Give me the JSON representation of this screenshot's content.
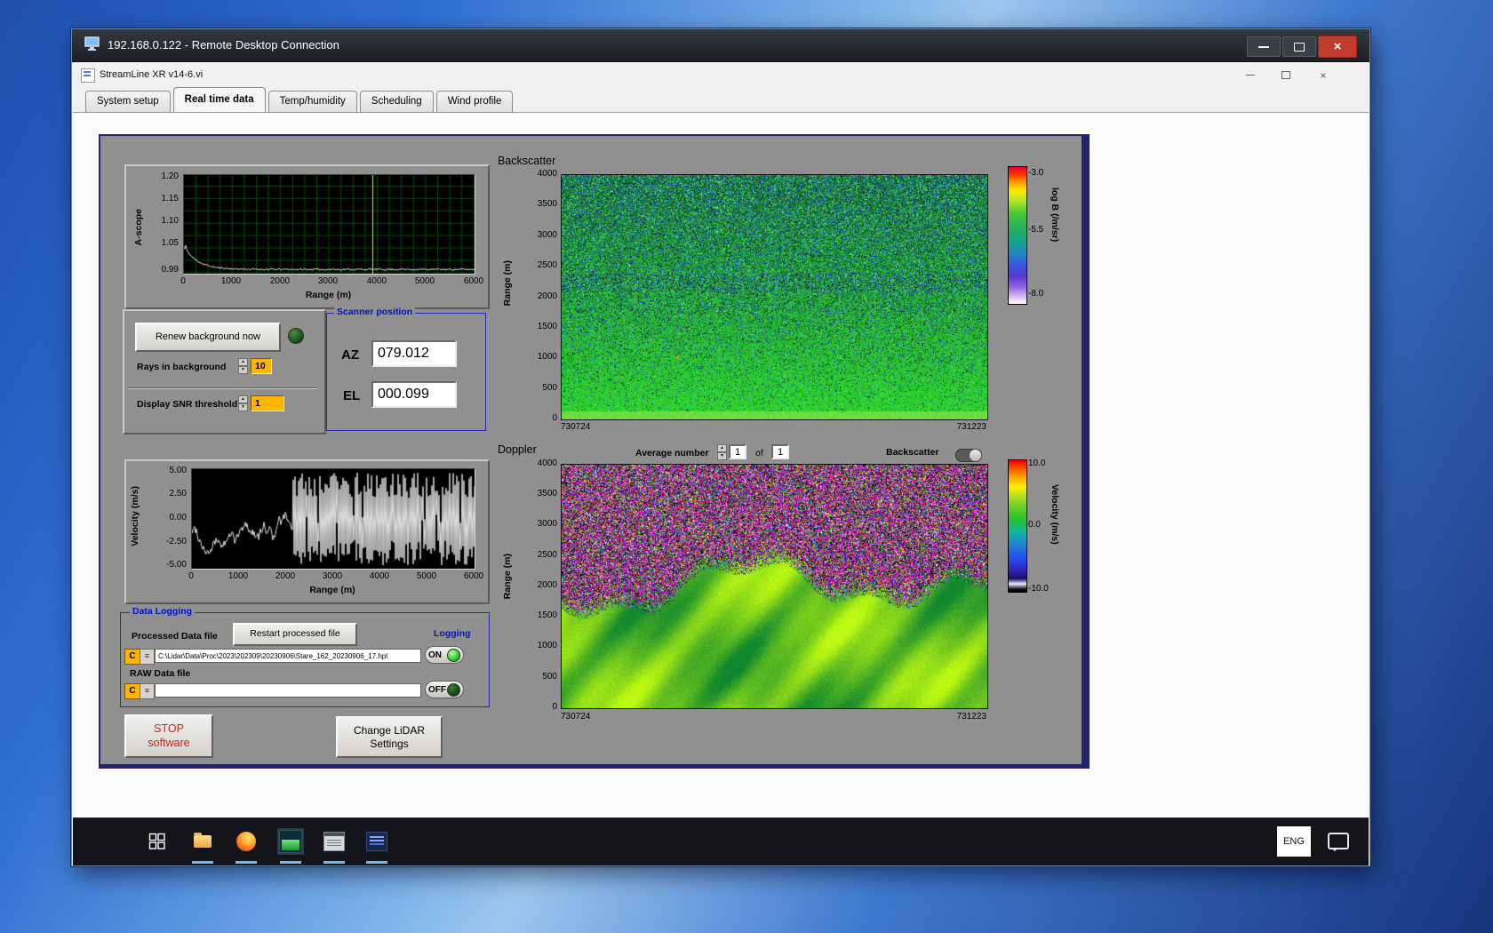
{
  "rdp": {
    "title": "192.168.0.122 - Remote Desktop Connection"
  },
  "app": {
    "title": "StreamLine XR v14-6.vi",
    "tabs": [
      "System setup",
      "Real time data",
      "Temp/humidity",
      "Scheduling",
      "Wind profile"
    ]
  },
  "ascope": {
    "ylabel": "A-scope",
    "xlabel": "Range (m)",
    "yticks": [
      "1.20",
      "1.15",
      "1.10",
      "1.05",
      "0.99"
    ],
    "xticks": [
      "0",
      "1000",
      "2000",
      "3000",
      "4000",
      "5000",
      "6000"
    ]
  },
  "background": {
    "renew_button": "Renew background now",
    "rays_label": "Rays in background",
    "rays_value": "10",
    "snr_label": "Display SNR threshold",
    "snr_value": "1"
  },
  "scanner": {
    "title": "Scanner position",
    "az_label": "AZ",
    "az_value": "079.012",
    "el_label": "EL",
    "el_value": "000.099"
  },
  "velocity": {
    "ylabel": "Velocity (m/s)",
    "xlabel": "Range (m)",
    "yticks": [
      "5.00",
      "2.50",
      "0.00",
      "-2.50",
      "-5.00"
    ],
    "xticks": [
      "0",
      "1000",
      "2000",
      "3000",
      "4000",
      "5000",
      "6000"
    ]
  },
  "logging": {
    "title": "Data Logging",
    "processed_label": "Processed Data file",
    "restart_button": "Restart processed file",
    "logging_label": "Logging",
    "drive": "C",
    "processed_path": "C:\\Lidar\\Data\\Proc\\2023\\202309\\20230906\\Stare_162_20230906_17.hpl",
    "processed_state": "ON",
    "raw_label": "RAW Data file",
    "raw_path": "",
    "raw_state": "OFF"
  },
  "actions": {
    "stop_line1": "STOP",
    "stop_line2": "software",
    "change_line1": "Change LiDAR",
    "change_line2": "Settings"
  },
  "backscatter": {
    "title": "Backscatter",
    "ylabel": "Range (m)",
    "yticks": [
      "4000",
      "3500",
      "3000",
      "2500",
      "2000",
      "1500",
      "1000",
      "500",
      "0"
    ],
    "x_start": "730724",
    "x_end": "731223",
    "colorbar_label": "log B (/m/sr)",
    "colorbar_ticks": [
      "-3.0",
      "-5.5",
      "-8.0"
    ]
  },
  "doppler": {
    "title": "Doppler",
    "avg_label": "Average number",
    "avg_value": "1",
    "of_label": "of",
    "of_total": "1",
    "toggle_label": "Backscatter",
    "ylabel": "Range (m)",
    "yticks": [
      "4000",
      "3500",
      "3000",
      "2500",
      "2000",
      "1500",
      "1000",
      "500",
      "0"
    ],
    "x_start": "730724",
    "x_end": "731223",
    "colorbar_label": "Velocity (m/s)",
    "colorbar_ticks": [
      "10.0",
      "0.0",
      "-10.0"
    ]
  },
  "taskbar": {
    "language": "ENG"
  },
  "colors": {
    "field_orange": "#ffb400",
    "label_blue": "#0012cc",
    "led_on": "#35e03a",
    "led_off": "#135013"
  }
}
